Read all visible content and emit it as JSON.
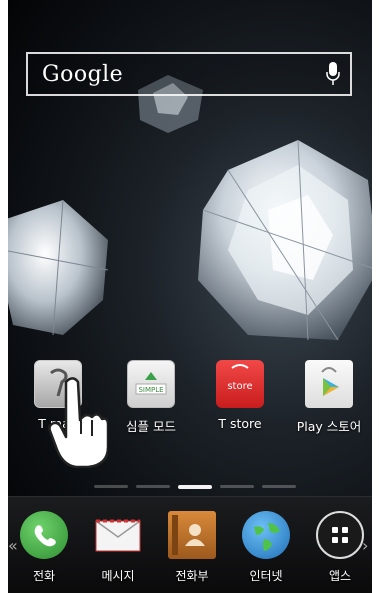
{
  "search": {
    "label": "Google"
  },
  "home_apps": [
    {
      "label": "T map"
    },
    {
      "label": "심플 모드"
    },
    {
      "label": "T store"
    },
    {
      "label": "Play 스토어"
    }
  ],
  "simple_icon_text": "SIMPLE",
  "tstore_icon_text": "store",
  "page_indicator": {
    "count": 5,
    "active": 3
  },
  "dock": [
    {
      "label": "전화"
    },
    {
      "label": "메시지"
    },
    {
      "label": "전화부"
    },
    {
      "label": "인터넷"
    },
    {
      "label": "앱스"
    }
  ],
  "colors": {
    "tstore": "#e52b2b",
    "phone": "#39a93b",
    "globe": "#2c8bd8"
  }
}
